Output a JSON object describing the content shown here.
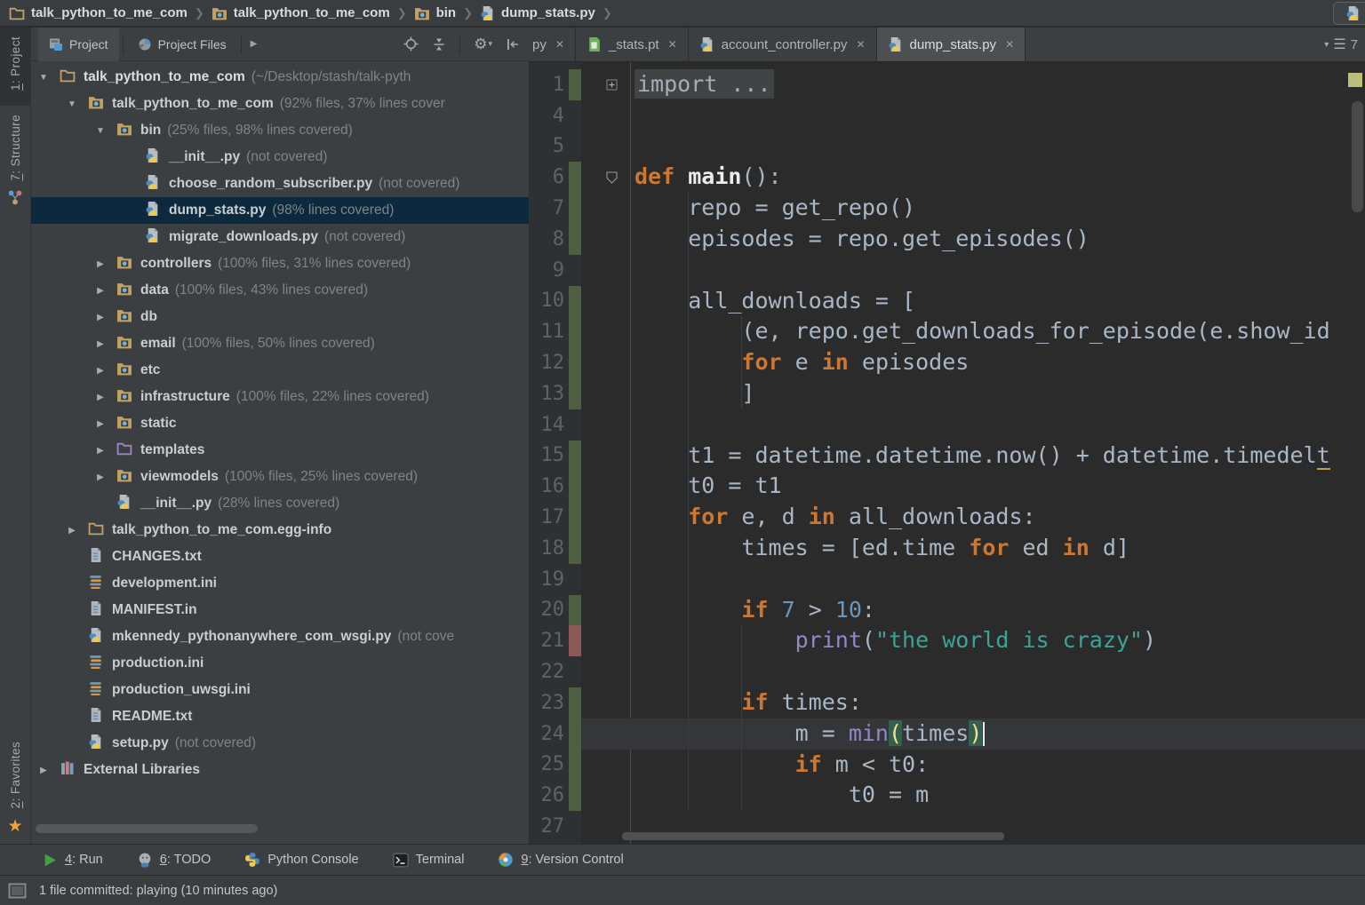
{
  "colors": {
    "panel-bg": "#3C3F41",
    "editor-bg": "#2B2B2B",
    "selection": "#0D293E",
    "caret-line": "#343639",
    "covered": "#4E5E41",
    "uncovered": "#8C5757",
    "keyword": "#CC7832",
    "number": "#6897BB",
    "string": "#3AA597",
    "builtin": "#9188C6",
    "default-text": "#A9B7C6"
  },
  "breadcrumbs": {
    "items": [
      {
        "icon": "folder",
        "label": "talk_python_to_me_com"
      },
      {
        "icon": "folder-src",
        "label": "talk_python_to_me_com"
      },
      {
        "icon": "folder-src",
        "label": "bin"
      },
      {
        "icon": "python-file",
        "label": "dump_stats.py"
      }
    ]
  },
  "stripe": {
    "top": [
      {
        "label": "1: Project",
        "icon": "project-tool",
        "active": true
      },
      {
        "label": "7: Structure",
        "icon": "structure-tool",
        "active": false
      }
    ],
    "bottom": [
      {
        "label": "2: Favorites",
        "icon": "star",
        "active": false
      }
    ]
  },
  "project_panel": {
    "tabs": [
      "Project",
      "Project Files"
    ],
    "tree": [
      {
        "level": 0,
        "arrow": "open",
        "icon": "folder",
        "name": "talk_python_to_me_com",
        "root": true,
        "info": "(~/Desktop/stash/talk-pyth"
      },
      {
        "level": 1,
        "arrow": "open",
        "icon": "folder-src",
        "name": "talk_python_to_me_com",
        "info": "(92% files, 37% lines cover"
      },
      {
        "level": 2,
        "arrow": "open",
        "icon": "folder-src",
        "name": "bin",
        "info": "(25% files, 98% lines covered)"
      },
      {
        "level": 3,
        "arrow": null,
        "icon": "python-file",
        "name": "__init__.py",
        "info": "(not covered)"
      },
      {
        "level": 3,
        "arrow": null,
        "icon": "python-file",
        "name": "choose_random_subscriber.py",
        "info": "(not covered)"
      },
      {
        "level": 3,
        "arrow": null,
        "icon": "python-file",
        "name": "dump_stats.py",
        "info": "(98% lines covered)",
        "selected": true
      },
      {
        "level": 3,
        "arrow": null,
        "icon": "python-file",
        "name": "migrate_downloads.py",
        "info": "(not covered)"
      },
      {
        "level": 2,
        "arrow": "closed",
        "icon": "folder-src",
        "name": "controllers",
        "info": "(100% files, 31% lines covered)"
      },
      {
        "level": 2,
        "arrow": "closed",
        "icon": "folder-src",
        "name": "data",
        "info": "(100% files, 43% lines covered)"
      },
      {
        "level": 2,
        "arrow": "closed",
        "icon": "folder-src",
        "name": "db",
        "info": ""
      },
      {
        "level": 2,
        "arrow": "closed",
        "icon": "folder-src",
        "name": "email",
        "info": "(100% files, 50% lines covered)"
      },
      {
        "level": 2,
        "arrow": "closed",
        "icon": "folder-src",
        "name": "etc",
        "info": ""
      },
      {
        "level": 2,
        "arrow": "closed",
        "icon": "folder-src",
        "name": "infrastructure",
        "info": "(100% files, 22% lines covered)"
      },
      {
        "level": 2,
        "arrow": "closed",
        "icon": "folder-src",
        "name": "static",
        "info": ""
      },
      {
        "level": 2,
        "arrow": "closed",
        "icon": "folder-template",
        "name": "templates",
        "info": ""
      },
      {
        "level": 2,
        "arrow": "closed",
        "icon": "folder-src",
        "name": "viewmodels",
        "info": "(100% files, 25% lines covered)"
      },
      {
        "level": 2,
        "arrow": null,
        "icon": "python-file",
        "name": "__init__.py",
        "info": "(28% lines covered)"
      },
      {
        "level": 1,
        "arrow": "closed",
        "icon": "folder",
        "name": "talk_python_to_me_com.egg-info",
        "info": ""
      },
      {
        "level": 1,
        "arrow": null,
        "icon": "text-file",
        "name": "CHANGES.txt",
        "info": ""
      },
      {
        "level": 1,
        "arrow": null,
        "icon": "ini-file",
        "name": "development.ini",
        "info": ""
      },
      {
        "level": 1,
        "arrow": null,
        "icon": "text-file",
        "name": "MANIFEST.in",
        "info": ""
      },
      {
        "level": 1,
        "arrow": null,
        "icon": "python-file",
        "name": "mkennedy_pythonanywhere_com_wsgi.py",
        "info": "(not cove"
      },
      {
        "level": 1,
        "arrow": null,
        "icon": "ini-file",
        "name": "production.ini",
        "info": ""
      },
      {
        "level": 1,
        "arrow": null,
        "icon": "ini-file",
        "name": "production_uwsgi.ini",
        "info": ""
      },
      {
        "level": 1,
        "arrow": null,
        "icon": "text-file",
        "name": "README.txt",
        "info": ""
      },
      {
        "level": 1,
        "arrow": null,
        "icon": "python-file",
        "name": "setup.py",
        "info": "(not covered)"
      },
      {
        "level": 0,
        "arrow": "closed",
        "icon": "library",
        "name": "External Libraries",
        "info": ""
      }
    ]
  },
  "editor": {
    "tabs": [
      {
        "label": "py",
        "icon": null,
        "partial": true,
        "active": false
      },
      {
        "label": "_stats.pt",
        "icon": "template-file",
        "active": false
      },
      {
        "label": "account_controller.py",
        "icon": "python-file",
        "active": false
      },
      {
        "label": "dump_stats.py",
        "icon": "python-file",
        "active": true
      }
    ],
    "tab_overflow_count": "7",
    "code_lines": [
      {
        "num": "1",
        "cov": "g",
        "fold": "plus",
        "segs": [
          [
            "fold",
            "import ..."
          ]
        ]
      },
      {
        "num": "4"
      },
      {
        "num": "5"
      },
      {
        "num": "6",
        "cov": "g",
        "fold": "open",
        "segs": [
          [
            "k",
            "def "
          ],
          [
            "fn",
            "main"
          ],
          [
            "d",
            "():"
          ]
        ]
      },
      {
        "num": "7",
        "cov": "g",
        "segs": [
          [
            "d",
            "    repo = get_repo()"
          ]
        ]
      },
      {
        "num": "8",
        "cov": "g",
        "segs": [
          [
            "d",
            "    episodes = repo.get_episodes()"
          ]
        ]
      },
      {
        "num": "9"
      },
      {
        "num": "10",
        "cov": "g",
        "segs": [
          [
            "d",
            "    all_downloads = ["
          ]
        ]
      },
      {
        "num": "11",
        "cov": "g",
        "segs": [
          [
            "d",
            "        (e, repo.get_downloads_for_episode(e.show_id"
          ]
        ]
      },
      {
        "num": "12",
        "cov": "g",
        "segs": [
          [
            "d",
            "        "
          ],
          [
            "k",
            "for"
          ],
          [
            "d",
            " e "
          ],
          [
            "k",
            "in"
          ],
          [
            "d",
            " episodes"
          ]
        ]
      },
      {
        "num": "13",
        "cov": "g",
        "segs": [
          [
            "d",
            "        ]"
          ]
        ]
      },
      {
        "num": "14"
      },
      {
        "num": "15",
        "cov": "g",
        "segs": [
          [
            "d",
            "    t1 = datetime.datetime.now() + datetime.timedel"
          ],
          [
            "warn",
            "t"
          ]
        ]
      },
      {
        "num": "16",
        "cov": "g",
        "segs": [
          [
            "d",
            "    t0 = t1"
          ]
        ]
      },
      {
        "num": "17",
        "cov": "g",
        "segs": [
          [
            "d",
            "    "
          ],
          [
            "k",
            "for"
          ],
          [
            "d",
            " e, d "
          ],
          [
            "k",
            "in"
          ],
          [
            "d",
            " all_downloads:"
          ]
        ]
      },
      {
        "num": "18",
        "cov": "g",
        "segs": [
          [
            "d",
            "        times = [ed.time "
          ],
          [
            "k",
            "for"
          ],
          [
            "d",
            " ed "
          ],
          [
            "k",
            "in"
          ],
          [
            "d",
            " d]"
          ]
        ]
      },
      {
        "num": "19"
      },
      {
        "num": "20",
        "cov": "g",
        "segs": [
          [
            "d",
            "        "
          ],
          [
            "k",
            "if"
          ],
          [
            "d",
            " "
          ],
          [
            "n",
            "7"
          ],
          [
            "d",
            " > "
          ],
          [
            "n",
            "10"
          ],
          [
            "d",
            ":"
          ]
        ]
      },
      {
        "num": "21",
        "cov": "r",
        "segs": [
          [
            "d",
            "            "
          ],
          [
            "b",
            "print"
          ],
          [
            "d",
            "("
          ],
          [
            "s",
            "\"the world is crazy\""
          ],
          [
            "d",
            ")"
          ]
        ]
      },
      {
        "num": "22"
      },
      {
        "num": "23",
        "cov": "g",
        "segs": [
          [
            "d",
            "        "
          ],
          [
            "k",
            "if"
          ],
          [
            "d",
            " times:"
          ]
        ]
      },
      {
        "num": "24",
        "cov": "g",
        "current": true,
        "cursor": true,
        "segs": [
          [
            "d",
            "            m = "
          ],
          [
            "b",
            "min"
          ],
          [
            "pm",
            "("
          ],
          [
            "d",
            "times"
          ],
          [
            "pm",
            ")"
          ]
        ]
      },
      {
        "num": "25",
        "cov": "g",
        "segs": [
          [
            "d",
            "            "
          ],
          [
            "k",
            "if"
          ],
          [
            "d",
            " m < t0:"
          ]
        ]
      },
      {
        "num": "26",
        "cov": "g",
        "segs": [
          [
            "d",
            "                t0 = m"
          ]
        ]
      },
      {
        "num": "27"
      }
    ]
  },
  "bottom_bar": {
    "buttons": [
      {
        "icon": "run",
        "label": "4: Run"
      },
      {
        "icon": "todo",
        "label": "6: TODO"
      },
      {
        "icon": "python-logo",
        "label": "Python Console"
      },
      {
        "icon": "terminal",
        "label": "Terminal"
      },
      {
        "icon": "vcs",
        "label": "9: Version Control"
      }
    ]
  },
  "status_bar": {
    "text": "1 file committed: playing (10 minutes ago)"
  }
}
